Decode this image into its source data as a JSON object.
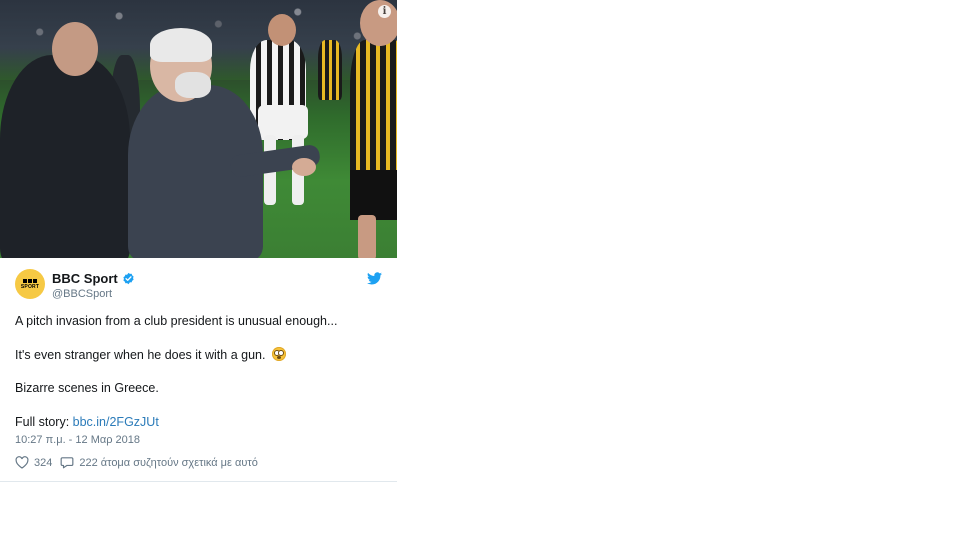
{
  "media": {
    "alt": "",
    "icon": "info-icon"
  },
  "tweet": {
    "avatar_badge": "BBC SPORT",
    "display_name": "BBC Sport",
    "handle": "@BBCSport",
    "text_lines": [
      "A pitch invasion from a club president is unusual enough...",
      "It's even stranger when he does it with a gun.",
      "Bizarre scenes in Greece."
    ],
    "full_story_prefix": "Full story: ",
    "full_story_link": "bbc.in/2FGzJUt",
    "timestamp": "10:27 π.μ. - 12 Μαρ 2018",
    "likes": "324",
    "replies": "222 άτομα συζητούν σχετικά με αυτό"
  },
  "colors": {
    "link": "#2b7bb9",
    "verified": "#1da1f2",
    "twitter_bird": "#1da1f2",
    "avatar_bg": "#f6c944",
    "secondary_text": "#657786"
  },
  "icons": {
    "verified": "verified-badge-icon",
    "brand": "twitter-bird-icon",
    "like": "heart-icon",
    "reply": "speech-bubble-icon",
    "emoji": "flushed-face-emoji"
  }
}
